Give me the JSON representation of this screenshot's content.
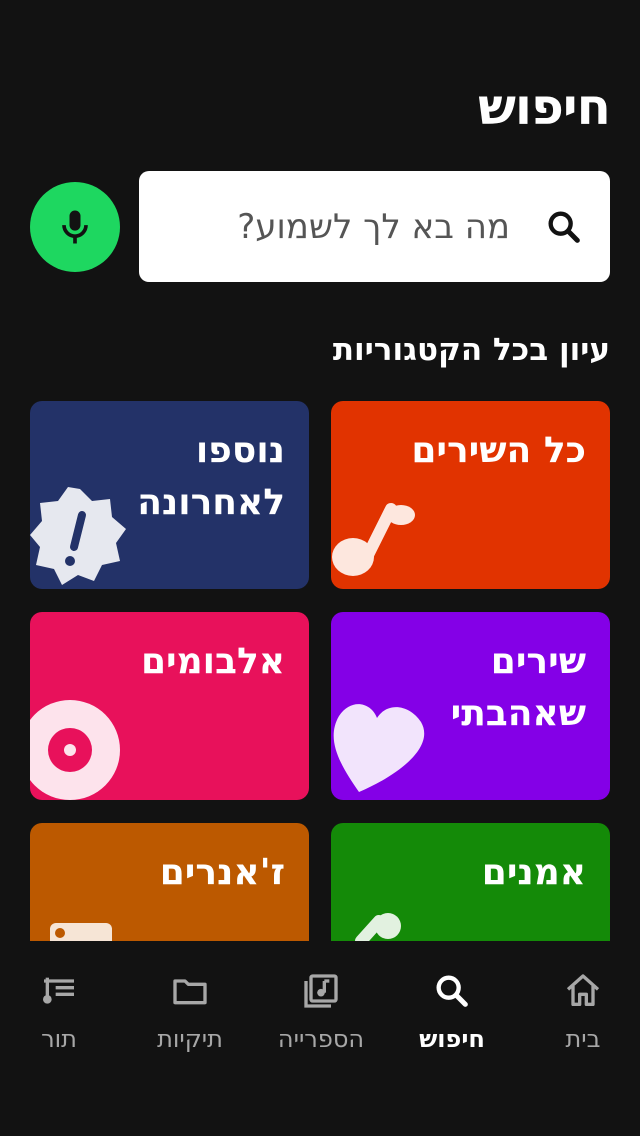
{
  "page": {
    "title": "חיפוש"
  },
  "search": {
    "placeholder": "מה בא לך לשמוע?"
  },
  "section": {
    "title": "עיון בכל הקטגוריות"
  },
  "categories": [
    {
      "label": "כל השירים",
      "color": "#e13300",
      "icon": "music-note-icon"
    },
    {
      "label": "נוספו לאחרונה",
      "color": "#233268",
      "icon": "new-badge-icon"
    },
    {
      "label": "שירים שאהבתי",
      "color": "#8400e7",
      "icon": "heart-icon"
    },
    {
      "label": "אלבומים",
      "color": "#e8115b",
      "icon": "disc-icon"
    },
    {
      "label": "אמנים",
      "color": "#148a08",
      "icon": "artist-icon"
    },
    {
      "label": "ז'אנרים",
      "color": "#bc5900",
      "icon": "genre-icon"
    }
  ],
  "nav": {
    "items": [
      {
        "label": "בית",
        "icon": "home-icon"
      },
      {
        "label": "חיפוש",
        "icon": "search-icon",
        "active": true
      },
      {
        "label": "הספרייה",
        "icon": "library-icon"
      },
      {
        "label": "תיקיות",
        "icon": "folder-icon"
      },
      {
        "label": "תור",
        "icon": "queue-icon"
      }
    ]
  },
  "colors": {
    "background": "#121212",
    "accent": "#1ed760"
  }
}
